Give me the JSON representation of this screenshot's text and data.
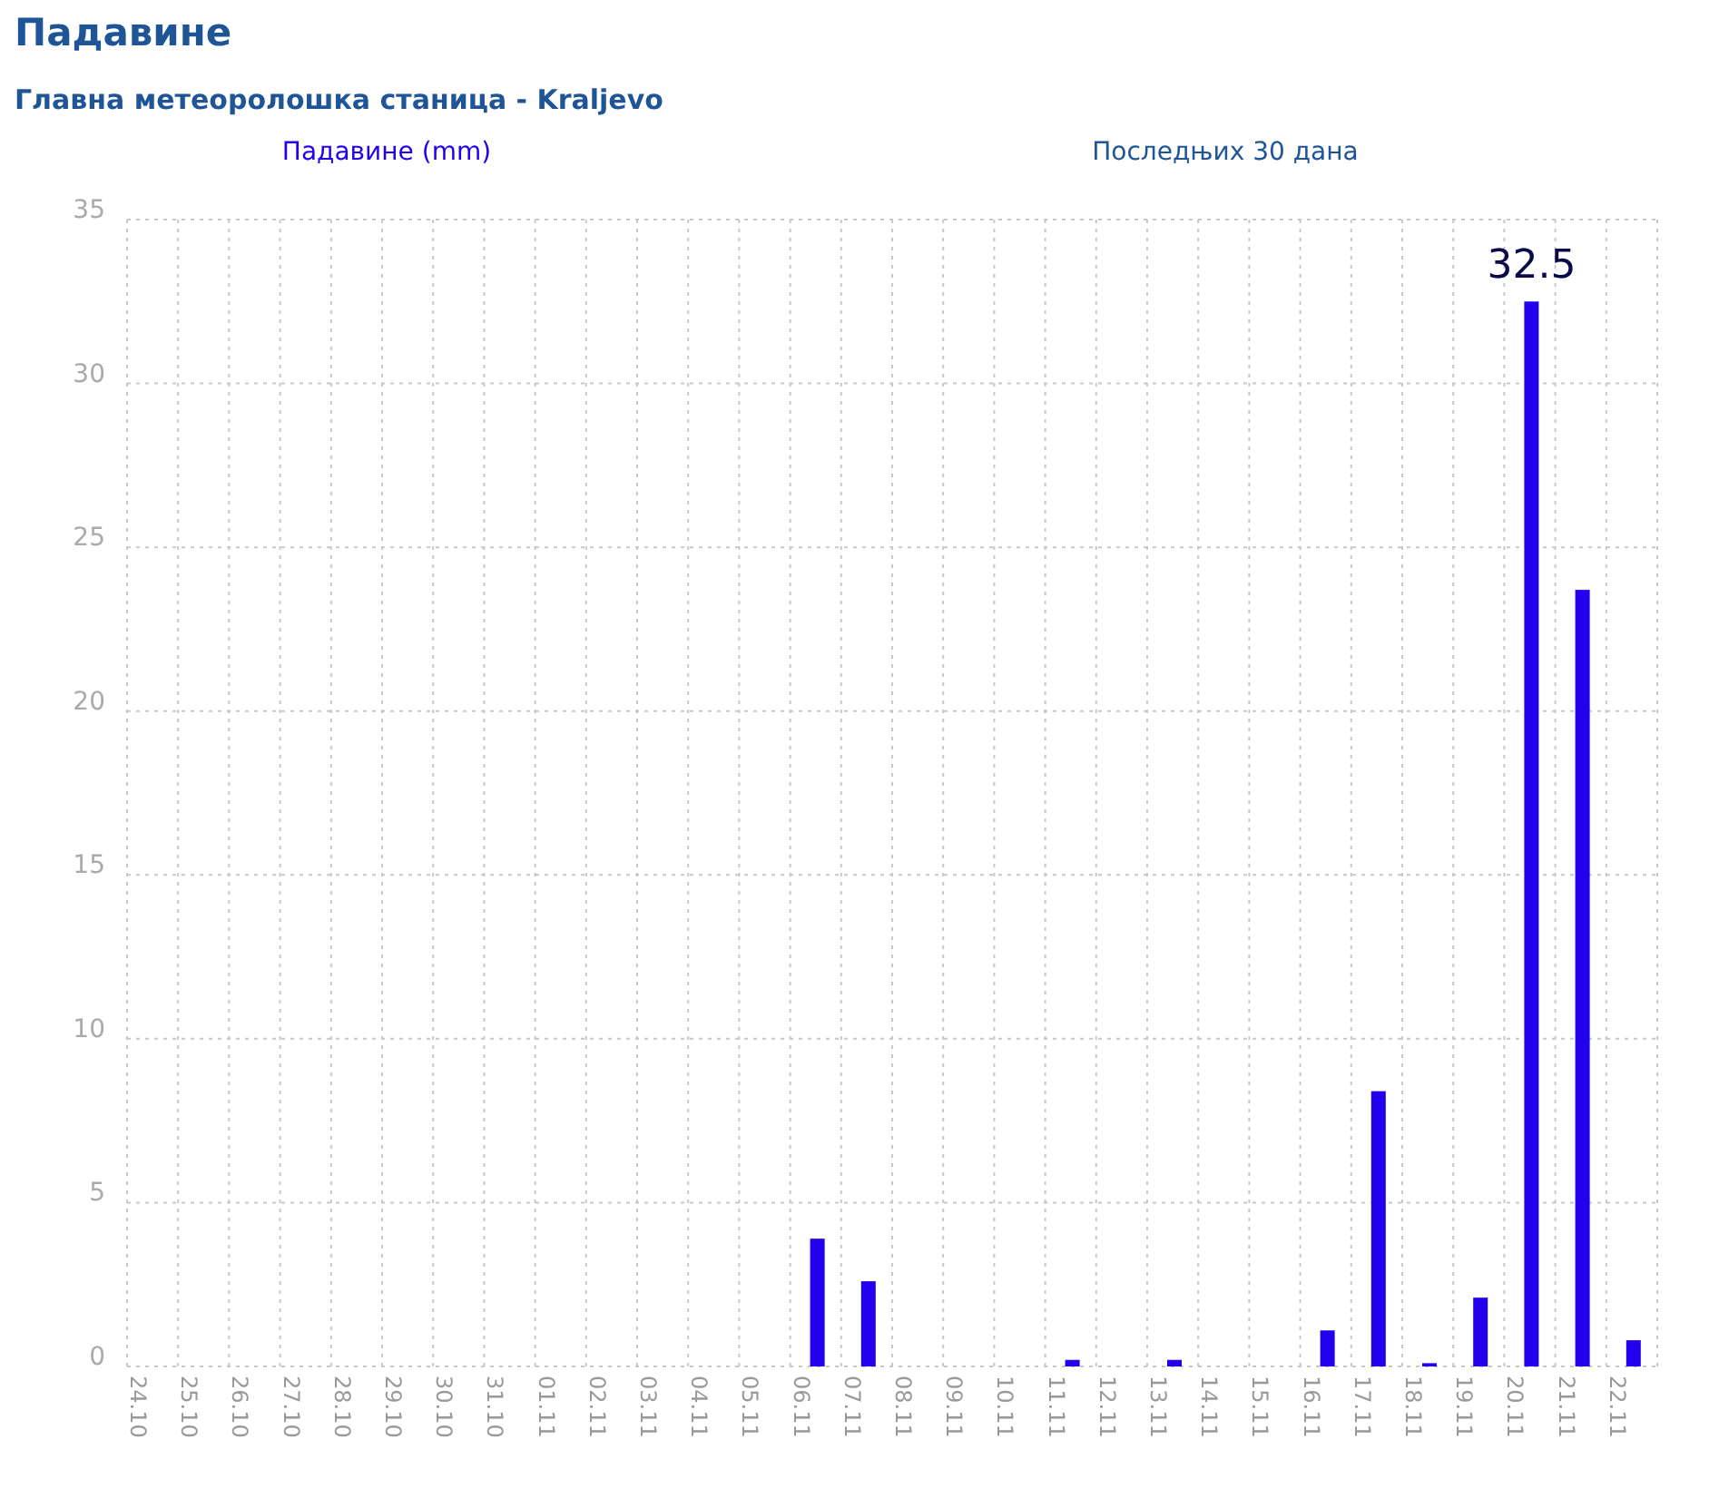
{
  "page_title": "Падавине",
  "station": "Главна метеоролошка станица - Kraljevo",
  "chart_data": {
    "type": "bar",
    "title": "Последњих 30 дана",
    "categories": [
      "24.10",
      "25.10",
      "26.10",
      "27.10",
      "28.10",
      "29.10",
      "30.10",
      "31.10",
      "01.11",
      "02.11",
      "03.11",
      "04.11",
      "05.11",
      "06.11",
      "07.11",
      "08.11",
      "09.11",
      "10.11",
      "11.11",
      "12.11",
      "13.11",
      "14.11",
      "15.11",
      "16.11",
      "17.11",
      "18.11",
      "19.11",
      "20.11",
      "21.11",
      "22.11"
    ],
    "series": [
      {
        "name": "Падавине (mm)",
        "color": "#2200ee",
        "values": [
          0,
          0,
          0,
          0,
          0,
          0,
          0,
          0,
          0,
          0,
          0,
          0,
          0,
          3.9,
          2.6,
          0,
          0,
          0,
          0.2,
          0,
          0.2,
          0,
          0,
          1.1,
          8.4,
          0.1,
          2.1,
          32.5,
          23.7,
          0.8
        ]
      }
    ],
    "ylim": [
      0,
      35
    ],
    "yticks": [
      0,
      5,
      10,
      15,
      20,
      25,
      30,
      35
    ],
    "grid": true,
    "annotations": [
      "32.5"
    ]
  }
}
